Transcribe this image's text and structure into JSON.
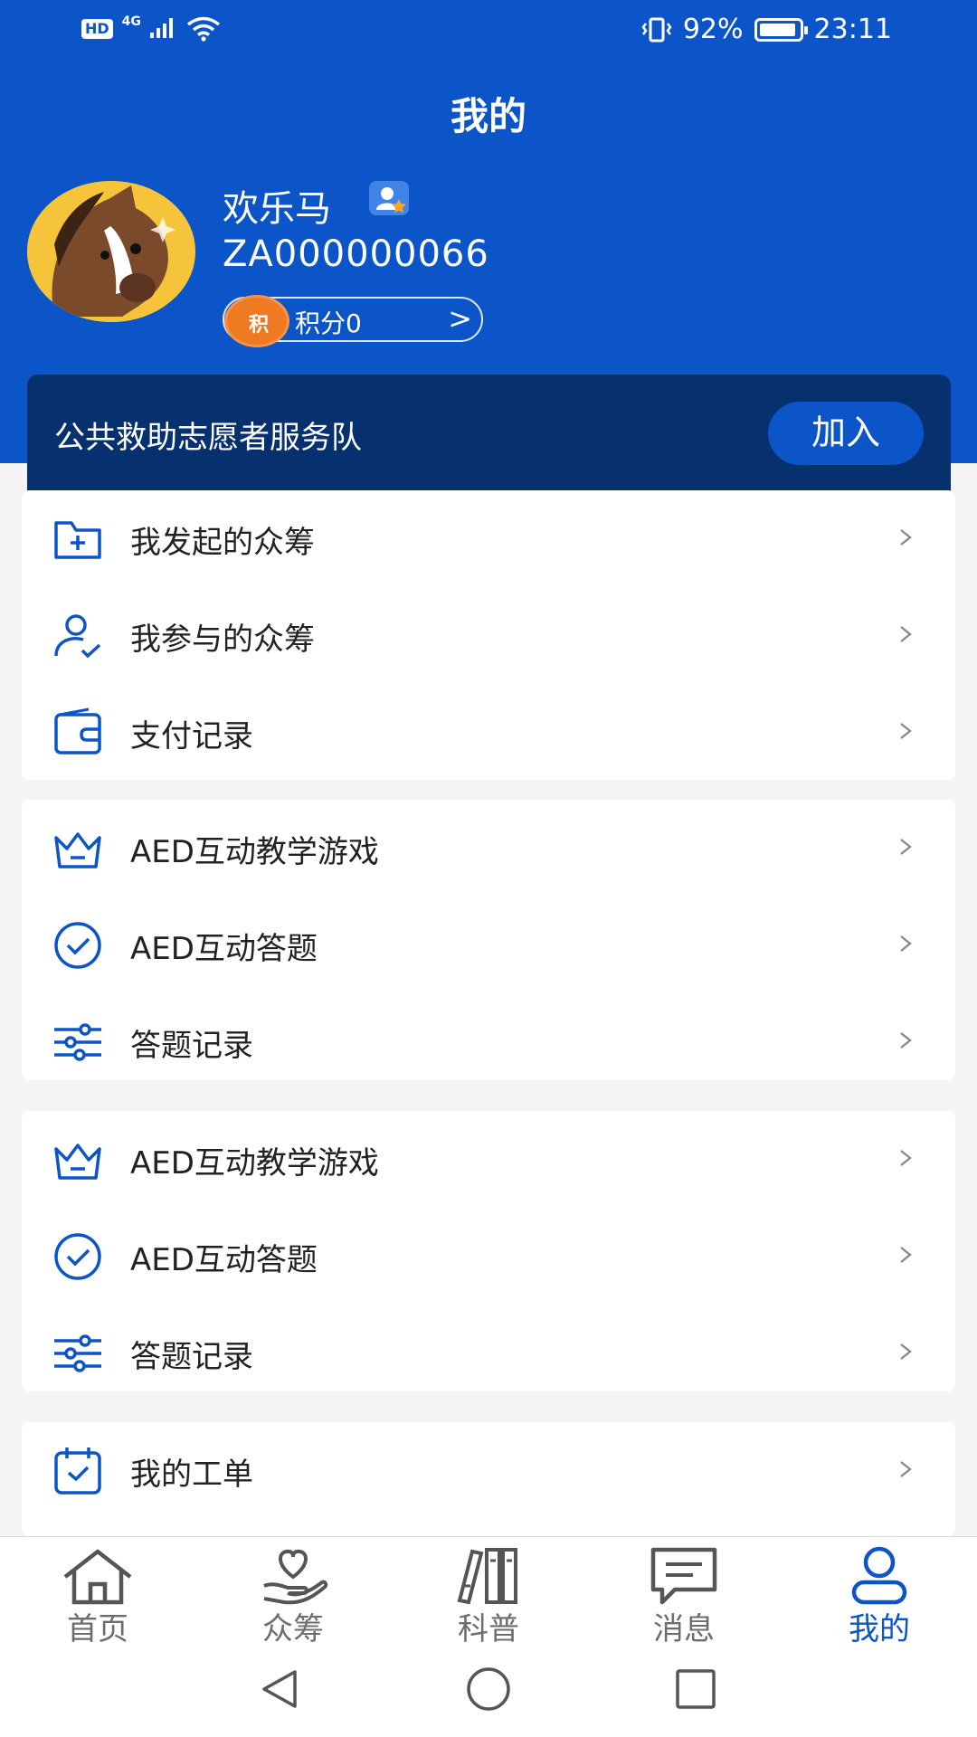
{
  "status_bar": {
    "hd": "HD",
    "network": "4G",
    "battery_percent": "92%",
    "battery_level": 0.92,
    "time": "23:11"
  },
  "header": {
    "title": "我的"
  },
  "profile": {
    "name": "欢乐马",
    "id": "ZA000000066",
    "points_icon_text": "积",
    "points_label": "积分0",
    "points_arrow": ">"
  },
  "volunteer": {
    "title": "公共救助志愿者服务队",
    "join_label": "加入"
  },
  "menu_groups": [
    {
      "items": [
        {
          "label": "我发起的众筹",
          "icon": "folder-add-icon"
        },
        {
          "label": "我参与的众筹",
          "icon": "user-check-icon"
        },
        {
          "label": "支付记录",
          "icon": "wallet-icon"
        }
      ]
    },
    {
      "items": [
        {
          "label": "AED互动教学游戏",
          "icon": "crown-icon"
        },
        {
          "label": "AED互动答题",
          "icon": "check-circle-icon"
        },
        {
          "label": "答题记录",
          "icon": "sliders-icon"
        }
      ]
    },
    {
      "items": [
        {
          "label": "AED互动教学游戏",
          "icon": "crown-icon"
        },
        {
          "label": "AED互动答题",
          "icon": "check-circle-icon"
        },
        {
          "label": "答题记录",
          "icon": "sliders-icon"
        }
      ]
    },
    {
      "items": [
        {
          "label": "我的工单",
          "icon": "calendar-check-icon"
        }
      ]
    }
  ],
  "tabs": [
    {
      "label": "首页",
      "icon": "home-icon"
    },
    {
      "label": "众筹",
      "icon": "heart-hand-icon"
    },
    {
      "label": "科普",
      "icon": "books-icon"
    },
    {
      "label": "消息",
      "icon": "message-icon"
    },
    {
      "label": "我的",
      "icon": "user-icon",
      "active": true
    }
  ],
  "colors": {
    "primary": "#0c55c9",
    "card_dark": "#07306f",
    "points_orange": "#f07a22",
    "text": "#222222",
    "tab_inactive": "#6d6d6d"
  }
}
